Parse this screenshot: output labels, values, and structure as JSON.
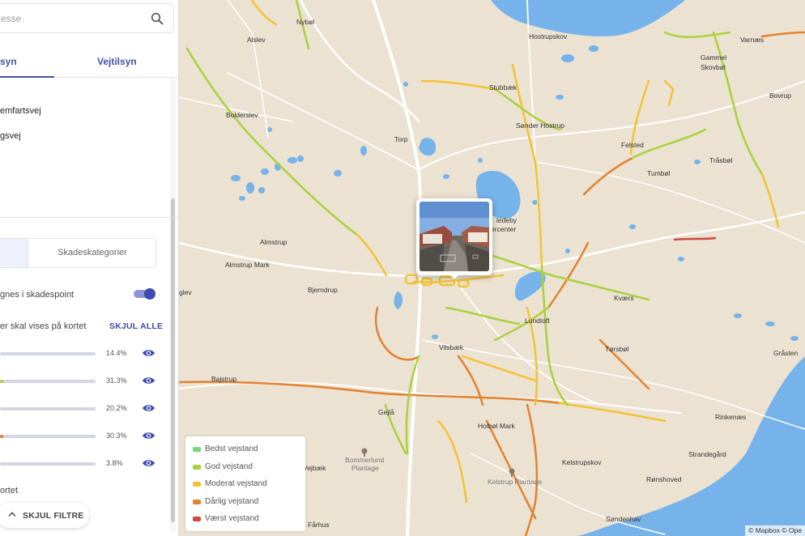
{
  "search": {
    "placeholder": "esse"
  },
  "tabs": [
    {
      "label": "syn"
    },
    {
      "label": "Vejtilsyn"
    }
  ],
  "roads": [
    {
      "label": "emfartsvej"
    },
    {
      "label": "gsvej"
    }
  ],
  "segment": {
    "right_label": "Skadeskategorier"
  },
  "toggle": {
    "label": "gnes i skadespoint",
    "on": true
  },
  "visibility": {
    "label": "er skal vises på kortet",
    "hide_all": "SKJUL ALLE"
  },
  "categories": [
    {
      "percent": "14.4%",
      "fill": 0.0,
      "color": "#7fd07f"
    },
    {
      "percent": "31.3%",
      "fill": 0.03,
      "color": "#a8cf3a"
    },
    {
      "percent": "20.2%",
      "fill": 0.0,
      "color": "#f2c230"
    },
    {
      "percent": "30.3%",
      "fill": 0.02,
      "color": "#e07b2c"
    },
    {
      "percent": "3.8%",
      "fill": 0.0,
      "color": "#d0403a"
    }
  ],
  "kortet": {
    "label": "ortet"
  },
  "hide_filters": {
    "label": "SKJUL FILTRE"
  },
  "legend": [
    {
      "label": "Bedst vejstand",
      "color": "#7bd47a"
    },
    {
      "label": "God vejstand",
      "color": "#a9d13d"
    },
    {
      "label": "Moderat vejstand",
      "color": "#f3c233"
    },
    {
      "label": "Dårlig vejstand",
      "color": "#e3812f"
    },
    {
      "label": "Værst vejstand",
      "color": "#d1483e"
    }
  ],
  "places": [
    {
      "name": "Nybøl"
    },
    {
      "name": "Alslev"
    },
    {
      "name": "Hostrupskov"
    },
    {
      "name": "Varnæs"
    },
    {
      "name": "Gammel"
    },
    {
      "name": "Skovbøl"
    },
    {
      "name": "Stubbæk"
    },
    {
      "name": "Bolderslev"
    },
    {
      "name": "Bovrup"
    },
    {
      "name": "Sønder Hostrup"
    },
    {
      "name": "Torp"
    },
    {
      "name": "Felsted"
    },
    {
      "name": "Tråsbøl"
    },
    {
      "name": "Tumbøl"
    },
    {
      "name": "ledeby"
    },
    {
      "name": "ercenter"
    },
    {
      "name": "Almstrup"
    },
    {
      "name": "Almstrup Mark"
    },
    {
      "name": "Bjerndrup"
    },
    {
      "name": "Kværs"
    },
    {
      "name": "glev"
    },
    {
      "name": "Lundtoft"
    },
    {
      "name": "Vilsbæk"
    },
    {
      "name": "Tørsbøl"
    },
    {
      "name": "Gråsten"
    },
    {
      "name": "Bajstrup"
    },
    {
      "name": "Gejlå"
    },
    {
      "name": "Holbøl Mark"
    },
    {
      "name": "Rinkenæs"
    },
    {
      "name": "Bommerlund"
    },
    {
      "name": "Plantage"
    },
    {
      "name": "Vejbæk"
    },
    {
      "name": "Kelstrupskov"
    },
    {
      "name": "Strandegård"
    },
    {
      "name": "Kelstrup Plantage"
    },
    {
      "name": "Rønshoved"
    },
    {
      "name": "Fårhus"
    },
    {
      "name": "Søndenhav"
    }
  ],
  "attribution": "© Mapbox © Ope"
}
